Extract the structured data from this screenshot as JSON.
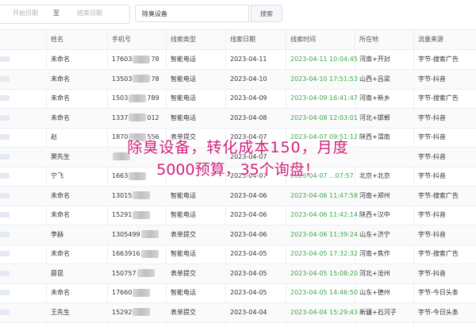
{
  "filters": {
    "start_date_placeholder": "开始日期",
    "separator": "至",
    "end_date_placeholder": "结束日期",
    "keyword_value": "除臭设备",
    "search_label": "搜索"
  },
  "table": {
    "columns": [
      "姓名",
      "手机号",
      "线索类型",
      "线索日期",
      "线索时间",
      "所在地",
      "流量来源"
    ],
    "rows": [
      {
        "name": "未命名",
        "phone_head": "17603",
        "phone_tail": "78",
        "type": "智能电话",
        "date": "2023-04-11",
        "time": "2023-04-11 10:04:45",
        "location": "河南+开封",
        "source": "字节-搜索广告"
      },
      {
        "name": "未命名",
        "phone_head": "13503",
        "phone_tail": "78",
        "type": "智能电话",
        "date": "2023-04-10",
        "time": "2023-04-10 17:51:53",
        "location": "山西+吕梁",
        "source": "字节-抖音"
      },
      {
        "name": "未命名",
        "phone_head": "1503",
        "phone_tail": "789",
        "type": "智能电话",
        "date": "2023-04-09",
        "time": "2023-04-09 16:41:47",
        "location": "河南+新乡",
        "source": "字节-搜索广告"
      },
      {
        "name": "未命名",
        "phone_head": "1337",
        "phone_tail": "012",
        "type": "智能电话",
        "date": "2023-04-08",
        "time": "2023-04-08 12:03:01",
        "location": "河北+邯郸",
        "source": "字节-抖音"
      },
      {
        "name": "赵",
        "phone_head": "1870",
        "phone_tail": "556",
        "type": "表单提交",
        "date": "2023-04-07",
        "time": "2023-04-07 09:51:12",
        "location": "陕西+渭南",
        "source": "字节-抖音"
      },
      {
        "name": "窦先生",
        "phone_head": "",
        "phone_tail": "",
        "type": "",
        "date": "2023-04-07",
        "time": "",
        "location": "",
        "source": "字节-抖音"
      },
      {
        "name": "宁飞",
        "phone_head": "1663",
        "phone_tail": "",
        "type": "",
        "date": "2023-04-07",
        "time": "2023-04-07 ...07:57",
        "location": "北京+北京",
        "source": "字节-抖音"
      },
      {
        "name": "未命名",
        "phone_head": "13015",
        "phone_tail": "",
        "type": "智能电话",
        "date": "2023-04-06",
        "time": "2023-04-06 11:47:58",
        "location": "河南+郑州",
        "source": "字节-搜索广告"
      },
      {
        "name": "未命名",
        "phone_head": "15291",
        "phone_tail": "",
        "type": "智能电话",
        "date": "2023-04-06",
        "time": "2023-04-06 11:42:14",
        "location": "陕西+汉中",
        "source": "字节-抖音"
      },
      {
        "name": "李赫",
        "phone_head": "1305499",
        "phone_tail": "",
        "type": "表单提交",
        "date": "2023-04-06",
        "time": "2023-04-06 11:39:24",
        "location": "山东+济宁",
        "source": "字节-抖音"
      },
      {
        "name": "未命名",
        "phone_head": "1663916",
        "phone_tail": "",
        "type": "智能电话",
        "date": "2023-04-05",
        "time": "2023-04-05 17:32:32",
        "location": "河南+焦作",
        "source": "字节-搜索广告"
      },
      {
        "name": "薛昆",
        "phone_head": "150757",
        "phone_tail": "",
        "type": "表单提交",
        "date": "2023-04-05",
        "time": "2023-04-05 15:08:20",
        "location": "河北+沧州",
        "source": "字节-抖音"
      },
      {
        "name": "未命名",
        "phone_head": "17660",
        "phone_tail": "",
        "type": "智能电话",
        "date": "2023-04-05",
        "time": "2023-04-05 14:46:50",
        "location": "山东+德州",
        "source": "字节-今日头条"
      },
      {
        "name": "王先生",
        "phone_head": "15292",
        "phone_tail": "",
        "type": "表单提交",
        "date": "2023-04-04",
        "time": "2023-04-04 15:29:43",
        "location": "新疆+石河子",
        "source": "字节-今日头条"
      }
    ]
  },
  "overlay": {
    "line1": "除臭设备，转化成本150，月度",
    "line2": "5000预算，35个询盘！",
    "color": "#d0207a"
  },
  "colors": {
    "time_text": "#3aa64a",
    "border": "#ebeef5"
  }
}
